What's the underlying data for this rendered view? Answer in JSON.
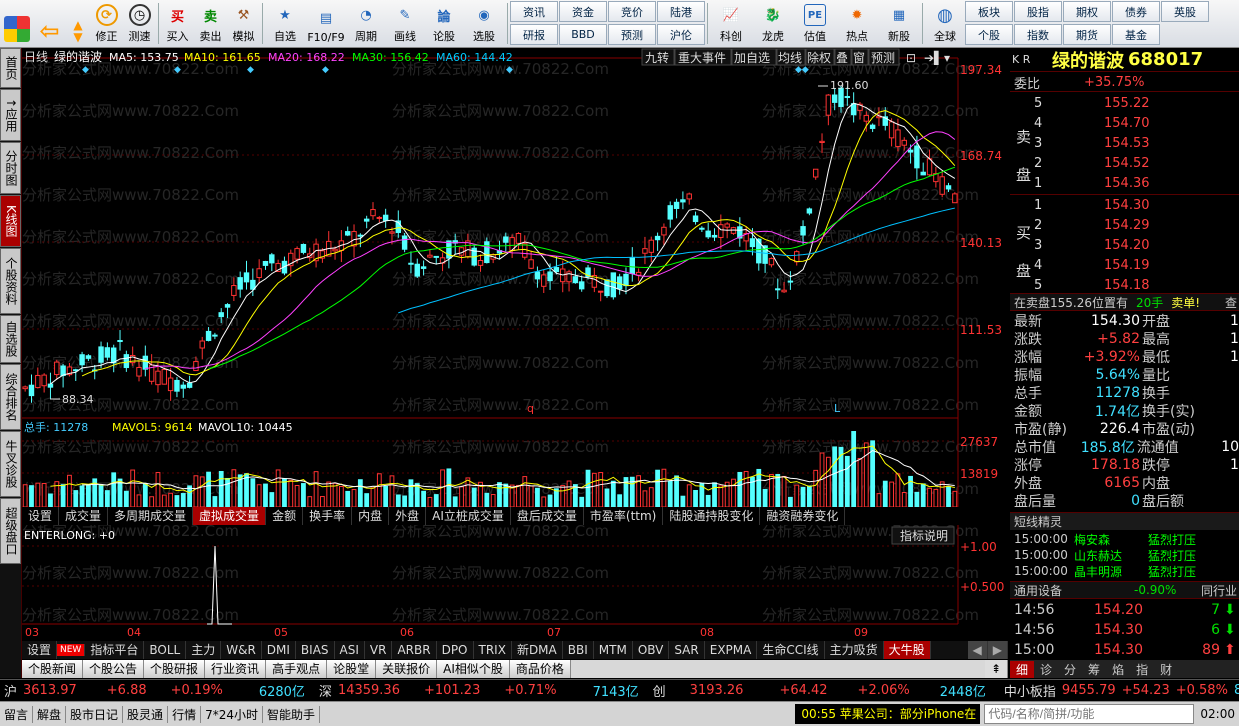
{
  "toolbar": {
    "left": [
      {
        "icon": "windows-icon",
        "label": ""
      },
      {
        "icon": "back-arrow-icon",
        "label": ""
      },
      {
        "icon": "up-down-icon",
        "label": ""
      },
      {
        "icon": "edit-icon",
        "label": "修正"
      },
      {
        "icon": "clock-icon",
        "label": "测速"
      },
      {
        "icon": "buy-icon",
        "label": "买入"
      },
      {
        "icon": "sell-icon",
        "label": "卖出"
      },
      {
        "icon": "hammer-icon",
        "label": "模拟"
      },
      {
        "icon": "star-icon",
        "label": "自选"
      },
      {
        "icon": "f10-icon",
        "label": "F10/F9"
      },
      {
        "icon": "period-icon",
        "label": "周期"
      },
      {
        "icon": "pencil-icon",
        "label": "画线"
      },
      {
        "icon": "lungu-icon",
        "label": "论股"
      },
      {
        "icon": "select-icon",
        "label": "选股"
      }
    ],
    "grid1": [
      "资讯",
      "研报",
      "资金",
      "BBD",
      "竞价",
      "预测",
      "陆港",
      "沪伦"
    ],
    "right": [
      {
        "icon": "kechuang-icon",
        "label": "科创"
      },
      {
        "icon": "dragon-tiger-icon",
        "label": "龙虎"
      },
      {
        "icon": "pe-icon",
        "label": "估值"
      },
      {
        "icon": "hot-icon",
        "label": "热点"
      },
      {
        "icon": "new-stock-icon",
        "label": "新股"
      },
      {
        "icon": "globe-icon",
        "label": "全球"
      }
    ],
    "grid2": [
      "板块",
      "个股",
      "股指",
      "指数",
      "期权",
      "期货",
      "债券",
      "基金",
      "英股"
    ]
  },
  "sidetabs": [
    "首页",
    "↑应用",
    "分时图",
    "K线图",
    "个股资料",
    "自选股",
    "综合排名",
    "牛叉诊股",
    "超级盘口"
  ],
  "chart": {
    "period": "日线",
    "name": "绿的谐波",
    "ma5": "MA5: 153.75",
    "ma10": "MA10: 161.65",
    "ma20": "MA20: 168.22",
    "ma30": "MA30: 156.42",
    "ma60": "MA60: 144.42",
    "buttons": [
      "九转",
      "重大事件",
      "加自选",
      "均线",
      "除权",
      "叠",
      "窗",
      "预测"
    ],
    "yticks": [
      "197.34",
      "168.74",
      "140.13",
      "111.53"
    ],
    "high_label": "191.60",
    "low_label": "88.34",
    "vol_label": "总手: 11278",
    "mavol5": "MAVOL5: 9614",
    "mavol10": "MAVOL10: 10445",
    "vol_ticks": [
      "27637",
      "13819"
    ],
    "ind_label": "ENTERLONG: +0",
    "ind_help": "指标说明",
    "ind_ticks": [
      "+1.00",
      "+0.500"
    ],
    "x_months": [
      "03",
      "04",
      "05",
      "06",
      "07",
      "08",
      "09"
    ],
    "watermark": "分析家公式网www.70822.Com"
  },
  "indtabs": [
    "设置",
    "成交量",
    "多周期成交量",
    "虚拟成交量",
    "金额",
    "换手率",
    "内盘",
    "外盘",
    "AI立桩成交量",
    "盘后成交量",
    "市盈率(ttm)",
    "陆股通持股变化",
    "融资融券变化"
  ],
  "btabs": [
    "设置",
    "NEW",
    "指标平台",
    "BOLL",
    "主力",
    "W&R",
    "DMI",
    "BIAS",
    "ASI",
    "VR",
    "ARBR",
    "DPO",
    "TRIX",
    "新DMA",
    "BBI",
    "MTM",
    "OBV",
    "SAR",
    "EXPMA",
    "生命CCI线",
    "主力吸货",
    "大牛股"
  ],
  "ntabs": [
    "个股新闻",
    "个股公告",
    "个股研报",
    "行业资讯",
    "高手观点",
    "论股堂",
    "关联报价",
    "AI相似个股",
    "商品价格"
  ],
  "quote": {
    "kr": "K R",
    "name": "绿的谐波",
    "code": "688017",
    "weibi_label": "委比",
    "weibi": "+35.75%",
    "sell": [
      [
        "5",
        "155.22"
      ],
      [
        "4",
        "154.70"
      ],
      [
        "3",
        "154.53"
      ],
      [
        "2",
        "154.52"
      ],
      [
        "1",
        "154.36"
      ]
    ],
    "buy": [
      [
        "1",
        "154.30"
      ],
      [
        "2",
        "154.29"
      ],
      [
        "3",
        "154.20"
      ],
      [
        "4",
        "154.19"
      ],
      [
        "5",
        "154.18"
      ]
    ],
    "sell_label": "卖盘",
    "buy_label": "买盘",
    "notice": "在卖盘155.26位置有",
    "notice_qty": "20手",
    "notice_tag": "卖单!",
    "notice_btn": "查",
    "stats": [
      [
        "最新",
        "154.30",
        "开盘",
        "1"
      ],
      [
        "涨跌",
        "+5.82",
        "最高",
        "1"
      ],
      [
        "涨幅",
        "+3.92%",
        "最低",
        "1"
      ],
      [
        "振幅",
        "5.64%",
        "量比",
        ""
      ],
      [
        "总手",
        "11278",
        "换手",
        ""
      ],
      [
        "金额",
        "1.74亿",
        "换手(实)",
        ""
      ],
      [
        "市盈(静)",
        "226.4",
        "市盈(动)",
        ""
      ],
      [
        "总市值",
        "185.8亿",
        "流通值",
        "10"
      ],
      [
        "涨停",
        "178.18",
        "跌停",
        "1"
      ],
      [
        "外盘",
        "6165",
        "内盘",
        ""
      ],
      [
        "盘后量",
        "0",
        "盘后额",
        ""
      ]
    ],
    "sprite_title": "短线精灵",
    "sprite": [
      [
        "15:00:00",
        "梅安森",
        "猛烈打压"
      ],
      [
        "15:00:00",
        "山东赫达",
        "猛烈打压"
      ],
      [
        "15:00:00",
        "晶丰明源",
        "猛烈打压"
      ]
    ],
    "sector": "通用设备",
    "sector_pct": "-0.90%",
    "sector_btn": "同行业",
    "ticks": [
      [
        "14:56",
        "154.20",
        "7",
        "down"
      ],
      [
        "14:56",
        "154.30",
        "6",
        "down"
      ],
      [
        "15:00",
        "154.30",
        "89",
        "up"
      ]
    ],
    "bottom_tabs": [
      "细",
      "诊",
      "分",
      "筹",
      "焰",
      "指",
      "财"
    ]
  },
  "index_bar": [
    {
      "name": "沪",
      "val": "3613.97",
      "chg": "+6.88",
      "pct": "+0.19%",
      "amt": "6280亿"
    },
    {
      "name": "深",
      "val": "14359.36",
      "chg": "+101.23",
      "pct": "+0.71%",
      "amt": "7143亿"
    },
    {
      "name": "创",
      "val": "3193.26",
      "chg": "+64.42",
      "pct": "+2.06%",
      "amt": "2448亿"
    },
    {
      "name": "中小板指",
      "val": "9455.79",
      "chg": "+54.23",
      "pct": "+0.58%",
      "amt": "80"
    }
  ],
  "status": {
    "items": [
      "留言",
      "解盘",
      "股市日记",
      "股灵通",
      "行情",
      "7*24小时",
      "智能助手"
    ],
    "ticker": "00:55 苹果公司：部分iPhone在",
    "search_placeholder": "代码/名称/简拼/功能",
    "time": "02:00"
  }
}
